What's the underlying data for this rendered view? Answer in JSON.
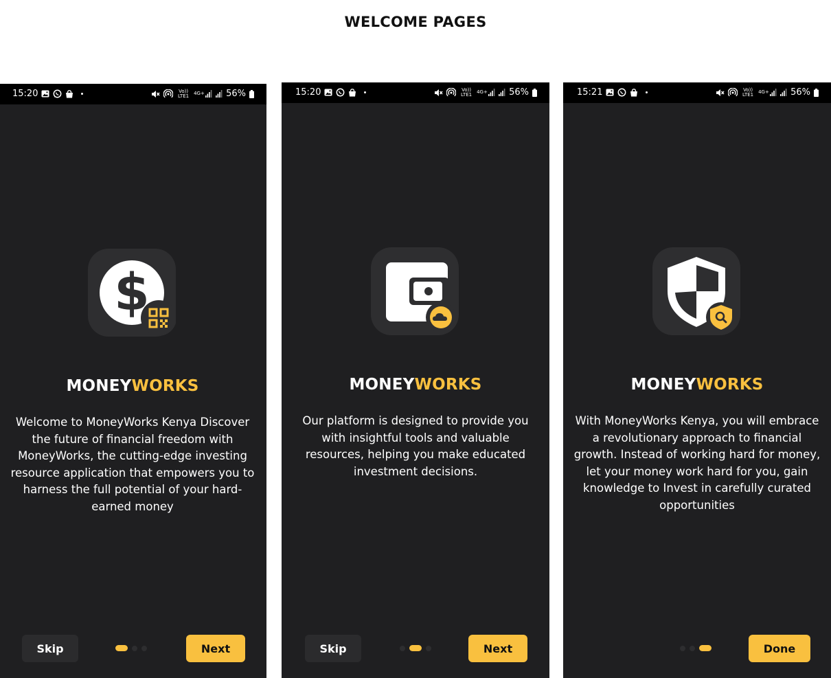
{
  "page": {
    "title": "WELCOME PAGES"
  },
  "colors": {
    "accent": "#f9c03f",
    "screen_bg": "#1f1f21",
    "icon_tile": "#2e2e30",
    "status_bar": "#000000"
  },
  "status_bar_common": {
    "battery": "56%",
    "icons": [
      "gallery-icon",
      "whatsapp-icon",
      "shopping-bag-icon",
      "mute-icon",
      "hotspot-icon",
      "volte-icon",
      "4g-icon",
      "signal-icon",
      "signal-icon",
      "battery-icon"
    ],
    "network": {
      "volte": "Vo)) LTE1",
      "gen": "4G+"
    }
  },
  "screens": [
    {
      "time": "15:20",
      "icon": "dollar-qr-icon",
      "brand": {
        "part1": "MONEY",
        "part2": "WORKS"
      },
      "description": "Welcome to MoneyWorks Kenya  Discover the future of financial freedom with MoneyWorks, the cutting-edge investing resource application that empowers you to harness the full potential of your hard-earned money",
      "skip_label": "Skip",
      "action_label": "Next",
      "active_dot": 0
    },
    {
      "time": "15:20",
      "icon": "wallet-cloud-icon",
      "brand": {
        "part1": "MONEY",
        "part2": "WORKS"
      },
      "description": "Our platform is designed to provide you with insightful tools and valuable resources, helping you make educated investment decisions.",
      "skip_label": "Skip",
      "action_label": "Next",
      "active_dot": 1
    },
    {
      "time": "15:21",
      "icon": "shield-search-icon",
      "brand": {
        "part1": "MONEY",
        "part2": "WORKS"
      },
      "description": "With MoneyWorks Kenya, you will embrace a revolutionary approach to financial growth. Instead of working hard for money, let your money work hard for you, gain knowledge to Invest in carefully curated opportunities",
      "action_label": "Done",
      "active_dot": 2
    }
  ]
}
